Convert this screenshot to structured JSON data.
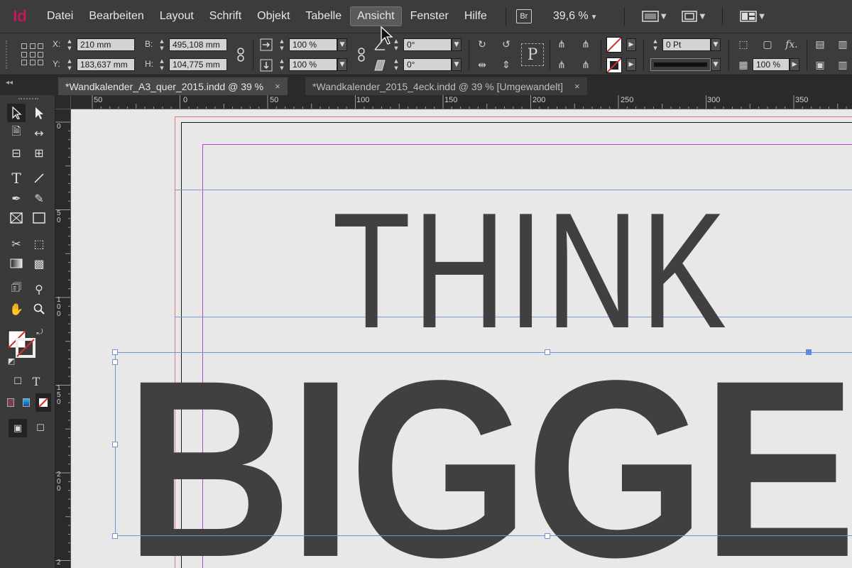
{
  "app": {
    "logo": "Id"
  },
  "menu": {
    "items": [
      "Datei",
      "Bearbeiten",
      "Layout",
      "Schrift",
      "Objekt",
      "Tabelle",
      "Ansicht",
      "Fenster",
      "Hilfe"
    ],
    "active_index": 6,
    "bridge_label": "Br",
    "zoom": "39,6 %"
  },
  "control": {
    "x_label": "X:",
    "x_value": "210 mm",
    "y_label": "Y:",
    "y_value": "183,637 mm",
    "w_label": "B:",
    "w_value": "495,108 mm",
    "h_label": "H:",
    "h_value": "104,775 mm",
    "scale_x": "100 %",
    "scale_y": "100 %",
    "rotate": "0°",
    "shear": "0°",
    "stroke_weight": "0 Pt",
    "opacity": "100 %"
  },
  "tabs": [
    {
      "label": "*Wandkalender_A3_quer_2015.indd @ 39 %",
      "close": "×"
    },
    {
      "label": "*Wandkalender_2015_4eck.indd @ 39 % [Umgewandelt]",
      "close": "×"
    }
  ],
  "ruler": {
    "h": [
      "50",
      "0",
      "50",
      "100",
      "150",
      "200",
      "250",
      "300",
      "350"
    ],
    "v": [
      "0",
      "50",
      "100",
      "150",
      "200",
      "2"
    ]
  },
  "document": {
    "line1": "THINK",
    "line2": "BIGGER"
  },
  "colors": {
    "accent_logo": "#c2185b",
    "bleed": "#e07a7a",
    "margin": "#b546d8",
    "guide": "#7c98d8",
    "text": "#404040"
  }
}
